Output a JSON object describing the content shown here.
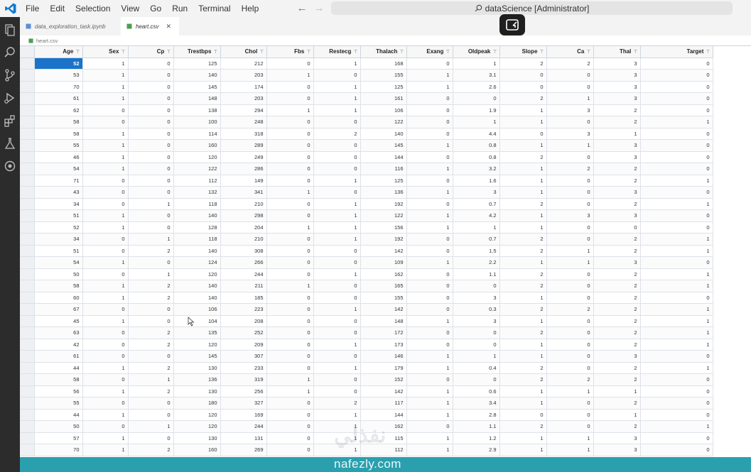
{
  "app": {
    "menu": [
      "File",
      "Edit",
      "Selection",
      "View",
      "Go",
      "Run",
      "Terminal",
      "Help"
    ],
    "search_text": "dataScience [Administrator]"
  },
  "tabs": [
    {
      "label": "data_exploration_task.ipynb",
      "active": false
    },
    {
      "label": "heart.csv",
      "active": true
    }
  ],
  "breadcrumb": "heart.csv",
  "table": {
    "columns": [
      "Age",
      "Sex",
      "Cp",
      "Trestbps",
      "Chol",
      "Fbs",
      "Restecg",
      "Thalach",
      "Exang",
      "Oldpeak",
      "Slope",
      "Ca",
      "Thal",
      "Target"
    ],
    "rows": [
      [
        "52",
        "1",
        "0",
        "125",
        "212",
        "0",
        "1",
        "168",
        "0",
        "1",
        "2",
        "2",
        "3",
        "0"
      ],
      [
        "53",
        "1",
        "0",
        "140",
        "203",
        "1",
        "0",
        "155",
        "1",
        "3.1",
        "0",
        "0",
        "3",
        "0"
      ],
      [
        "70",
        "1",
        "0",
        "145",
        "174",
        "0",
        "1",
        "125",
        "1",
        "2.6",
        "0",
        "0",
        "3",
        "0"
      ],
      [
        "61",
        "1",
        "0",
        "148",
        "203",
        "0",
        "1",
        "161",
        "0",
        "0",
        "2",
        "1",
        "3",
        "0"
      ],
      [
        "62",
        "0",
        "0",
        "138",
        "294",
        "1",
        "1",
        "106",
        "0",
        "1.9",
        "1",
        "3",
        "2",
        "0"
      ],
      [
        "58",
        "0",
        "0",
        "100",
        "248",
        "0",
        "0",
        "122",
        "0",
        "1",
        "1",
        "0",
        "2",
        "1"
      ],
      [
        "58",
        "1",
        "0",
        "114",
        "318",
        "0",
        "2",
        "140",
        "0",
        "4.4",
        "0",
        "3",
        "1",
        "0"
      ],
      [
        "55",
        "1",
        "0",
        "160",
        "289",
        "0",
        "0",
        "145",
        "1",
        "0.8",
        "1",
        "1",
        "3",
        "0"
      ],
      [
        "46",
        "1",
        "0",
        "120",
        "249",
        "0",
        "0",
        "144",
        "0",
        "0.8",
        "2",
        "0",
        "3",
        "0"
      ],
      [
        "54",
        "1",
        "0",
        "122",
        "286",
        "0",
        "0",
        "116",
        "1",
        "3.2",
        "1",
        "2",
        "2",
        "0"
      ],
      [
        "71",
        "0",
        "0",
        "112",
        "149",
        "0",
        "1",
        "125",
        "0",
        "1.6",
        "1",
        "0",
        "2",
        "1"
      ],
      [
        "43",
        "0",
        "0",
        "132",
        "341",
        "1",
        "0",
        "136",
        "1",
        "3",
        "1",
        "0",
        "3",
        "0"
      ],
      [
        "34",
        "0",
        "1",
        "118",
        "210",
        "0",
        "1",
        "192",
        "0",
        "0.7",
        "2",
        "0",
        "2",
        "1"
      ],
      [
        "51",
        "1",
        "0",
        "140",
        "298",
        "0",
        "1",
        "122",
        "1",
        "4.2",
        "1",
        "3",
        "3",
        "0"
      ],
      [
        "52",
        "1",
        "0",
        "128",
        "204",
        "1",
        "1",
        "156",
        "1",
        "1",
        "1",
        "0",
        "0",
        "0"
      ],
      [
        "34",
        "0",
        "1",
        "118",
        "210",
        "0",
        "1",
        "192",
        "0",
        "0.7",
        "2",
        "0",
        "2",
        "1"
      ],
      [
        "51",
        "0",
        "2",
        "140",
        "308",
        "0",
        "0",
        "142",
        "0",
        "1.5",
        "2",
        "1",
        "2",
        "1"
      ],
      [
        "54",
        "1",
        "0",
        "124",
        "266",
        "0",
        "0",
        "109",
        "1",
        "2.2",
        "1",
        "1",
        "3",
        "0"
      ],
      [
        "50",
        "0",
        "1",
        "120",
        "244",
        "0",
        "1",
        "162",
        "0",
        "1.1",
        "2",
        "0",
        "2",
        "1"
      ],
      [
        "58",
        "1",
        "2",
        "140",
        "211",
        "1",
        "0",
        "165",
        "0",
        "0",
        "2",
        "0",
        "2",
        "1"
      ],
      [
        "60",
        "1",
        "2",
        "140",
        "185",
        "0",
        "0",
        "155",
        "0",
        "3",
        "1",
        "0",
        "2",
        "0"
      ],
      [
        "67",
        "0",
        "0",
        "106",
        "223",
        "0",
        "1",
        "142",
        "0",
        "0.3",
        "2",
        "2",
        "2",
        "1"
      ],
      [
        "45",
        "1",
        "0",
        "104",
        "208",
        "0",
        "0",
        "148",
        "1",
        "3",
        "1",
        "0",
        "2",
        "1"
      ],
      [
        "63",
        "0",
        "2",
        "135",
        "252",
        "0",
        "0",
        "172",
        "0",
        "0",
        "2",
        "0",
        "2",
        "1"
      ],
      [
        "42",
        "0",
        "2",
        "120",
        "209",
        "0",
        "1",
        "173",
        "0",
        "0",
        "1",
        "0",
        "2",
        "1"
      ],
      [
        "61",
        "0",
        "0",
        "145",
        "307",
        "0",
        "0",
        "146",
        "1",
        "1",
        "1",
        "0",
        "3",
        "0"
      ],
      [
        "44",
        "1",
        "2",
        "130",
        "233",
        "0",
        "1",
        "179",
        "1",
        "0.4",
        "2",
        "0",
        "2",
        "1"
      ],
      [
        "58",
        "0",
        "1",
        "136",
        "319",
        "1",
        "0",
        "152",
        "0",
        "0",
        "2",
        "2",
        "2",
        "0"
      ],
      [
        "56",
        "1",
        "2",
        "130",
        "256",
        "1",
        "0",
        "142",
        "1",
        "0.6",
        "1",
        "1",
        "1",
        "0"
      ],
      [
        "55",
        "0",
        "0",
        "180",
        "327",
        "0",
        "2",
        "117",
        "1",
        "3.4",
        "1",
        "0",
        "2",
        "0"
      ],
      [
        "44",
        "1",
        "0",
        "120",
        "169",
        "0",
        "1",
        "144",
        "1",
        "2.8",
        "0",
        "0",
        "1",
        "0"
      ],
      [
        "50",
        "0",
        "1",
        "120",
        "244",
        "0",
        "1",
        "162",
        "0",
        "1.1",
        "2",
        "0",
        "2",
        "1"
      ],
      [
        "57",
        "1",
        "0",
        "130",
        "131",
        "0",
        "1",
        "115",
        "1",
        "1.2",
        "1",
        "1",
        "3",
        "0"
      ],
      [
        "70",
        "1",
        "2",
        "160",
        "269",
        "0",
        "1",
        "112",
        "1",
        "2.9",
        "1",
        "1",
        "3",
        "0"
      ]
    ]
  },
  "watermark": "nafezly.com",
  "watermark_ghost": "نفذلي",
  "colors": {
    "status_bar": "#2aa0ae",
    "selected_cell": "#1a73c9",
    "vscode_blue": "#0e7ad1"
  }
}
